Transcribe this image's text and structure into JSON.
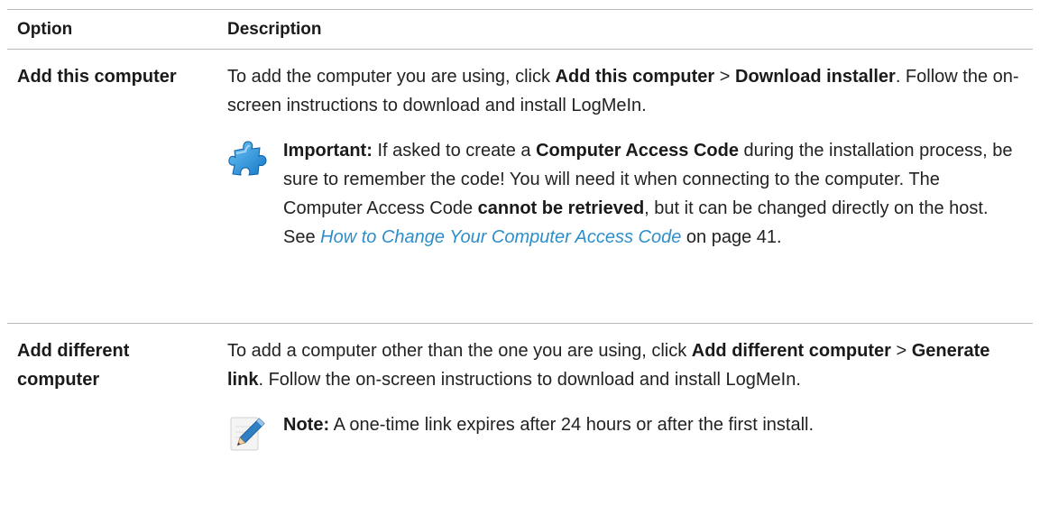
{
  "table": {
    "header": {
      "option": "Option",
      "description": "Description"
    },
    "rows": [
      {
        "option": "Add this computer",
        "desc": {
          "t1": "To add the computer you are using, click ",
          "b1": "Add this computer",
          "t2": " > ",
          "b2": "Download installer",
          "t3": ". Follow the on-screen instructions to download and install LogMeIn."
        },
        "callout": {
          "icon": "puzzle-piece-icon",
          "label": "Important:",
          "t1": "  If asked to create a ",
          "b1": "Computer Access Code",
          "t2": " during the installation process, be sure to remember the code! You will need it when connecting to the computer. The Computer Access Code ",
          "b2": "cannot be retrieved",
          "t3": ", but it can be changed directly on the host. See ",
          "link": "How to Change Your Computer Access Code",
          "t4": " on page 41."
        }
      },
      {
        "option": "Add different computer",
        "desc": {
          "t1": "To add a computer other than the one you are using, click ",
          "b1": "Add different computer",
          "t2": " > ",
          "b2": "Generate link",
          "t3": ". Follow the on-screen instructions to download and install LogMeIn."
        },
        "callout": {
          "icon": "pencil-note-icon",
          "label": "Note:",
          "t1": "  A one-time link expires after 24 hours or after the first install."
        }
      }
    ]
  },
  "colors": {
    "text": "#222222",
    "link": "#2e8ec9",
    "rule": "#b9b9b9",
    "puzzle_icon": "#2b8fd6"
  }
}
